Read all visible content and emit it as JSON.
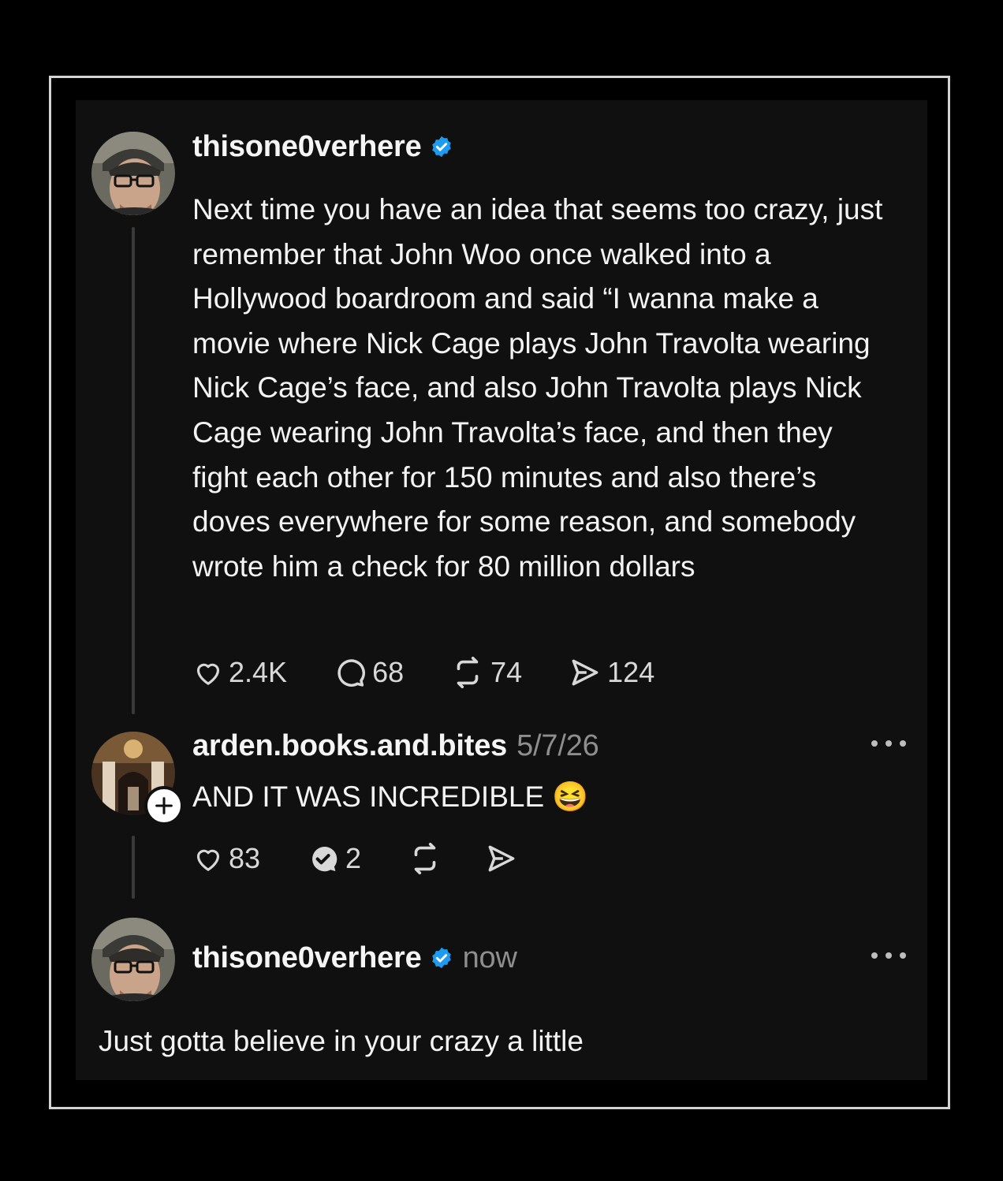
{
  "posts": [
    {
      "username": "thisone0verhere",
      "verified": true,
      "text": "Next time you have an idea that seems too crazy, just remember that John Woo once walked into a Hollywood boardroom and said “I wanna make a movie where Nick Cage plays John Travolta wearing Nick Cage’s face, and also John Travolta plays Nick Cage wearing John Travolta’s face, and then they fight each other for 150 minutes and also there’s doves everywhere for some reason, and somebody wrote him a check for 80 million dollars",
      "likes": "2.4K",
      "comments": "68",
      "reposts": "74",
      "shares": "124"
    },
    {
      "username": "arden.books.and.bites",
      "date": "5/7/26",
      "text": "AND IT WAS INCREDIBLE",
      "emoji": "😆",
      "likes": "83",
      "comments": "2"
    },
    {
      "username": "thisone0verhere",
      "verified": true,
      "time": "now",
      "text": "Just gotta believe in your crazy a little"
    }
  ],
  "colors": {
    "background": "#000000",
    "panel": "#101010",
    "verified": "#1d9bf0",
    "muted": "#8e8e8e"
  }
}
